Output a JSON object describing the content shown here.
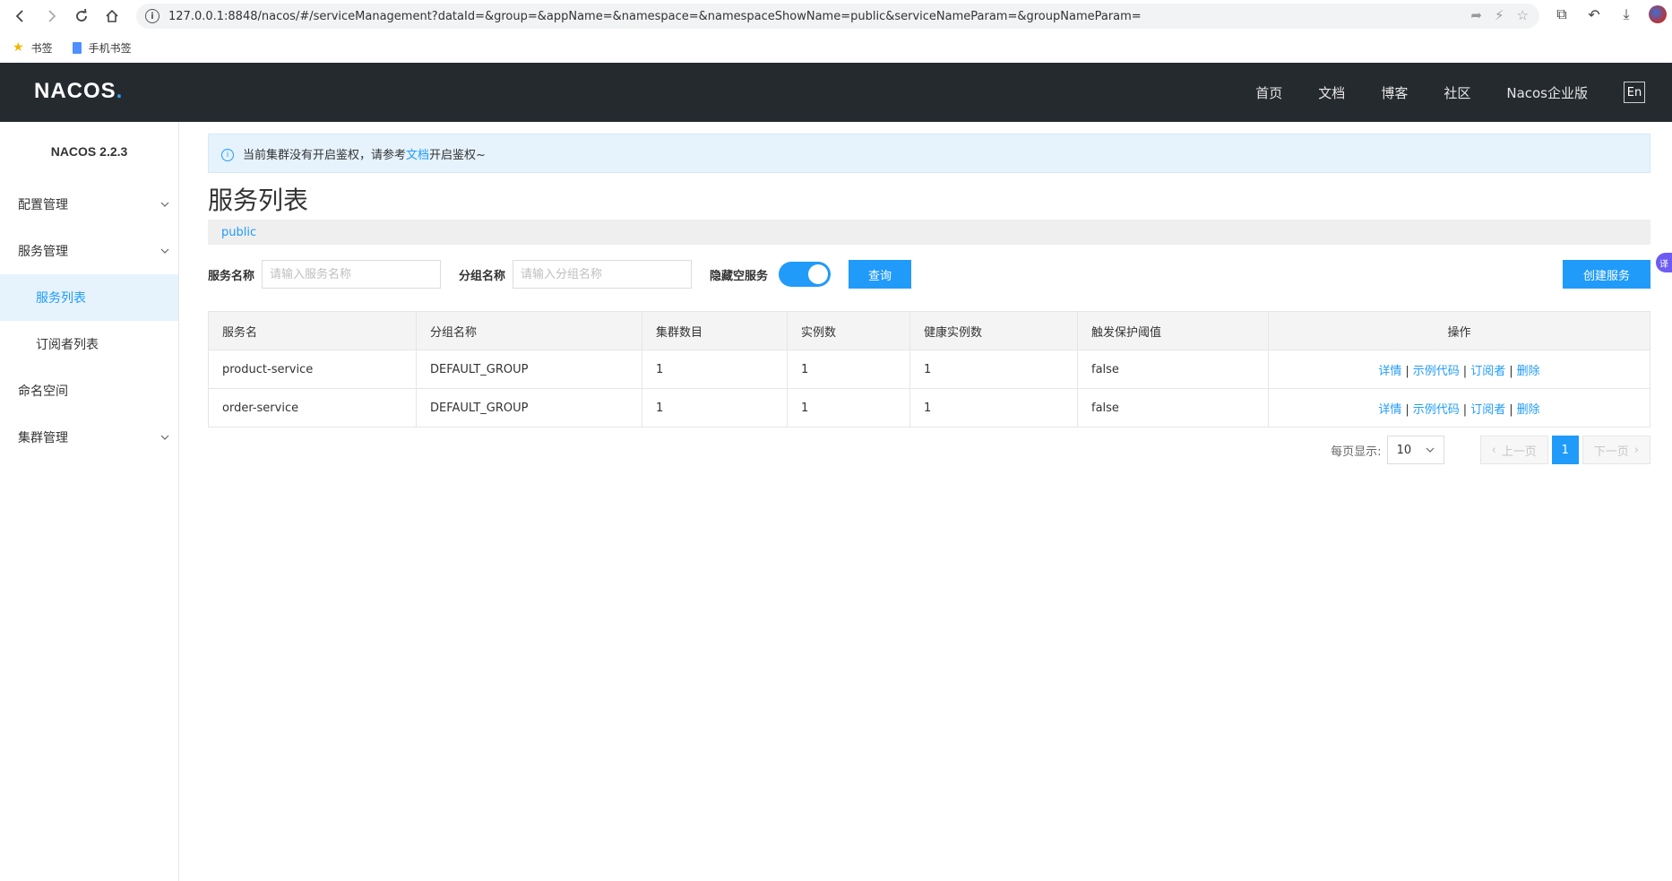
{
  "browser": {
    "url": "127.0.0.1:8848/nacos/#/serviceManagement?dataId=&group=&appName=&namespace=&namespaceShowName=public&serviceNameParam=&groupNameParam=",
    "bookmarks": [
      {
        "label": "书签",
        "icon": "star-icon"
      },
      {
        "label": "手机书签",
        "icon": "bookmark-folder-icon"
      }
    ]
  },
  "header": {
    "logo": "NACOS",
    "nav": [
      "首页",
      "文档",
      "博客",
      "社区",
      "Nacos企业版"
    ],
    "lang": "En"
  },
  "sidebar": {
    "version": "NACOS 2.2.3",
    "items": [
      {
        "label": "配置管理",
        "expandable": true
      },
      {
        "label": "服务管理",
        "expandable": true
      },
      {
        "label": "服务列表",
        "sub": true,
        "active": true
      },
      {
        "label": "订阅者列表",
        "sub": true
      },
      {
        "label": "命名空间",
        "expandable": false
      },
      {
        "label": "集群管理",
        "expandable": true
      }
    ]
  },
  "main": {
    "notice": {
      "before": "当前集群没有开启鉴权，请参考",
      "link": "文档",
      "after": "开启鉴权~"
    },
    "title": "服务列表",
    "namespace": "public",
    "filters": {
      "service_name_label": "服务名称",
      "service_name_placeholder": "请输入服务名称",
      "group_name_label": "分组名称",
      "group_name_placeholder": "请输入分组名称",
      "hide_empty_label": "隐藏空服务",
      "hide_empty_on": true,
      "query_button": "查询",
      "create_button": "创建服务"
    },
    "table": {
      "columns": [
        "服务名",
        "分组名称",
        "集群数目",
        "实例数",
        "健康实例数",
        "触发保护阈值",
        "操作"
      ],
      "rows": [
        [
          "product-service",
          "DEFAULT_GROUP",
          "1",
          "1",
          "1",
          "false"
        ],
        [
          "order-service",
          "DEFAULT_GROUP",
          "1",
          "1",
          "1",
          "false"
        ]
      ],
      "ops": [
        "详情",
        "示例代码",
        "订阅者",
        "删除"
      ]
    },
    "pager": {
      "page_size_label": "每页显示:",
      "page_size": "10",
      "prev": "上一页",
      "current": "1",
      "next": "下一页"
    }
  },
  "colors": {
    "accent": "#209bfa",
    "header_bg": "#252a2f",
    "notice_bg": "#e6f3fd"
  }
}
